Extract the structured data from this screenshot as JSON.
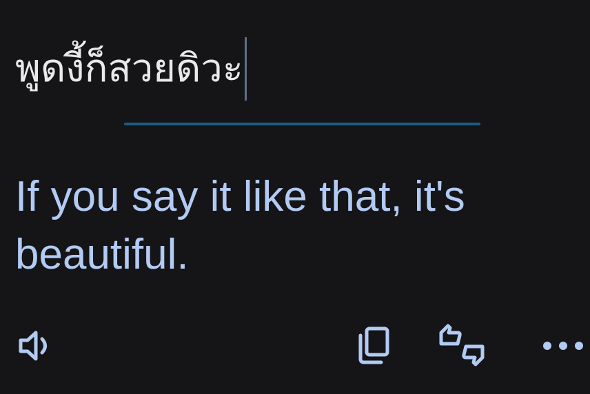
{
  "source": {
    "text": "พูดงี้ก็สวยดิวะ"
  },
  "translation": {
    "text": "If you say it like that, it's beautiful."
  },
  "toolbar": {
    "listen_icon": "speaker-icon",
    "copy_icon": "copy-icon",
    "feedback_icon": "thumbs-feedback-icon",
    "more_icon": "more-options-icon"
  },
  "colors": {
    "background": "#151518",
    "source_text": "#e9e9ec",
    "translation_text": "#b3cbf3",
    "divider": "#185d84",
    "icon": "#b3cbf3"
  }
}
